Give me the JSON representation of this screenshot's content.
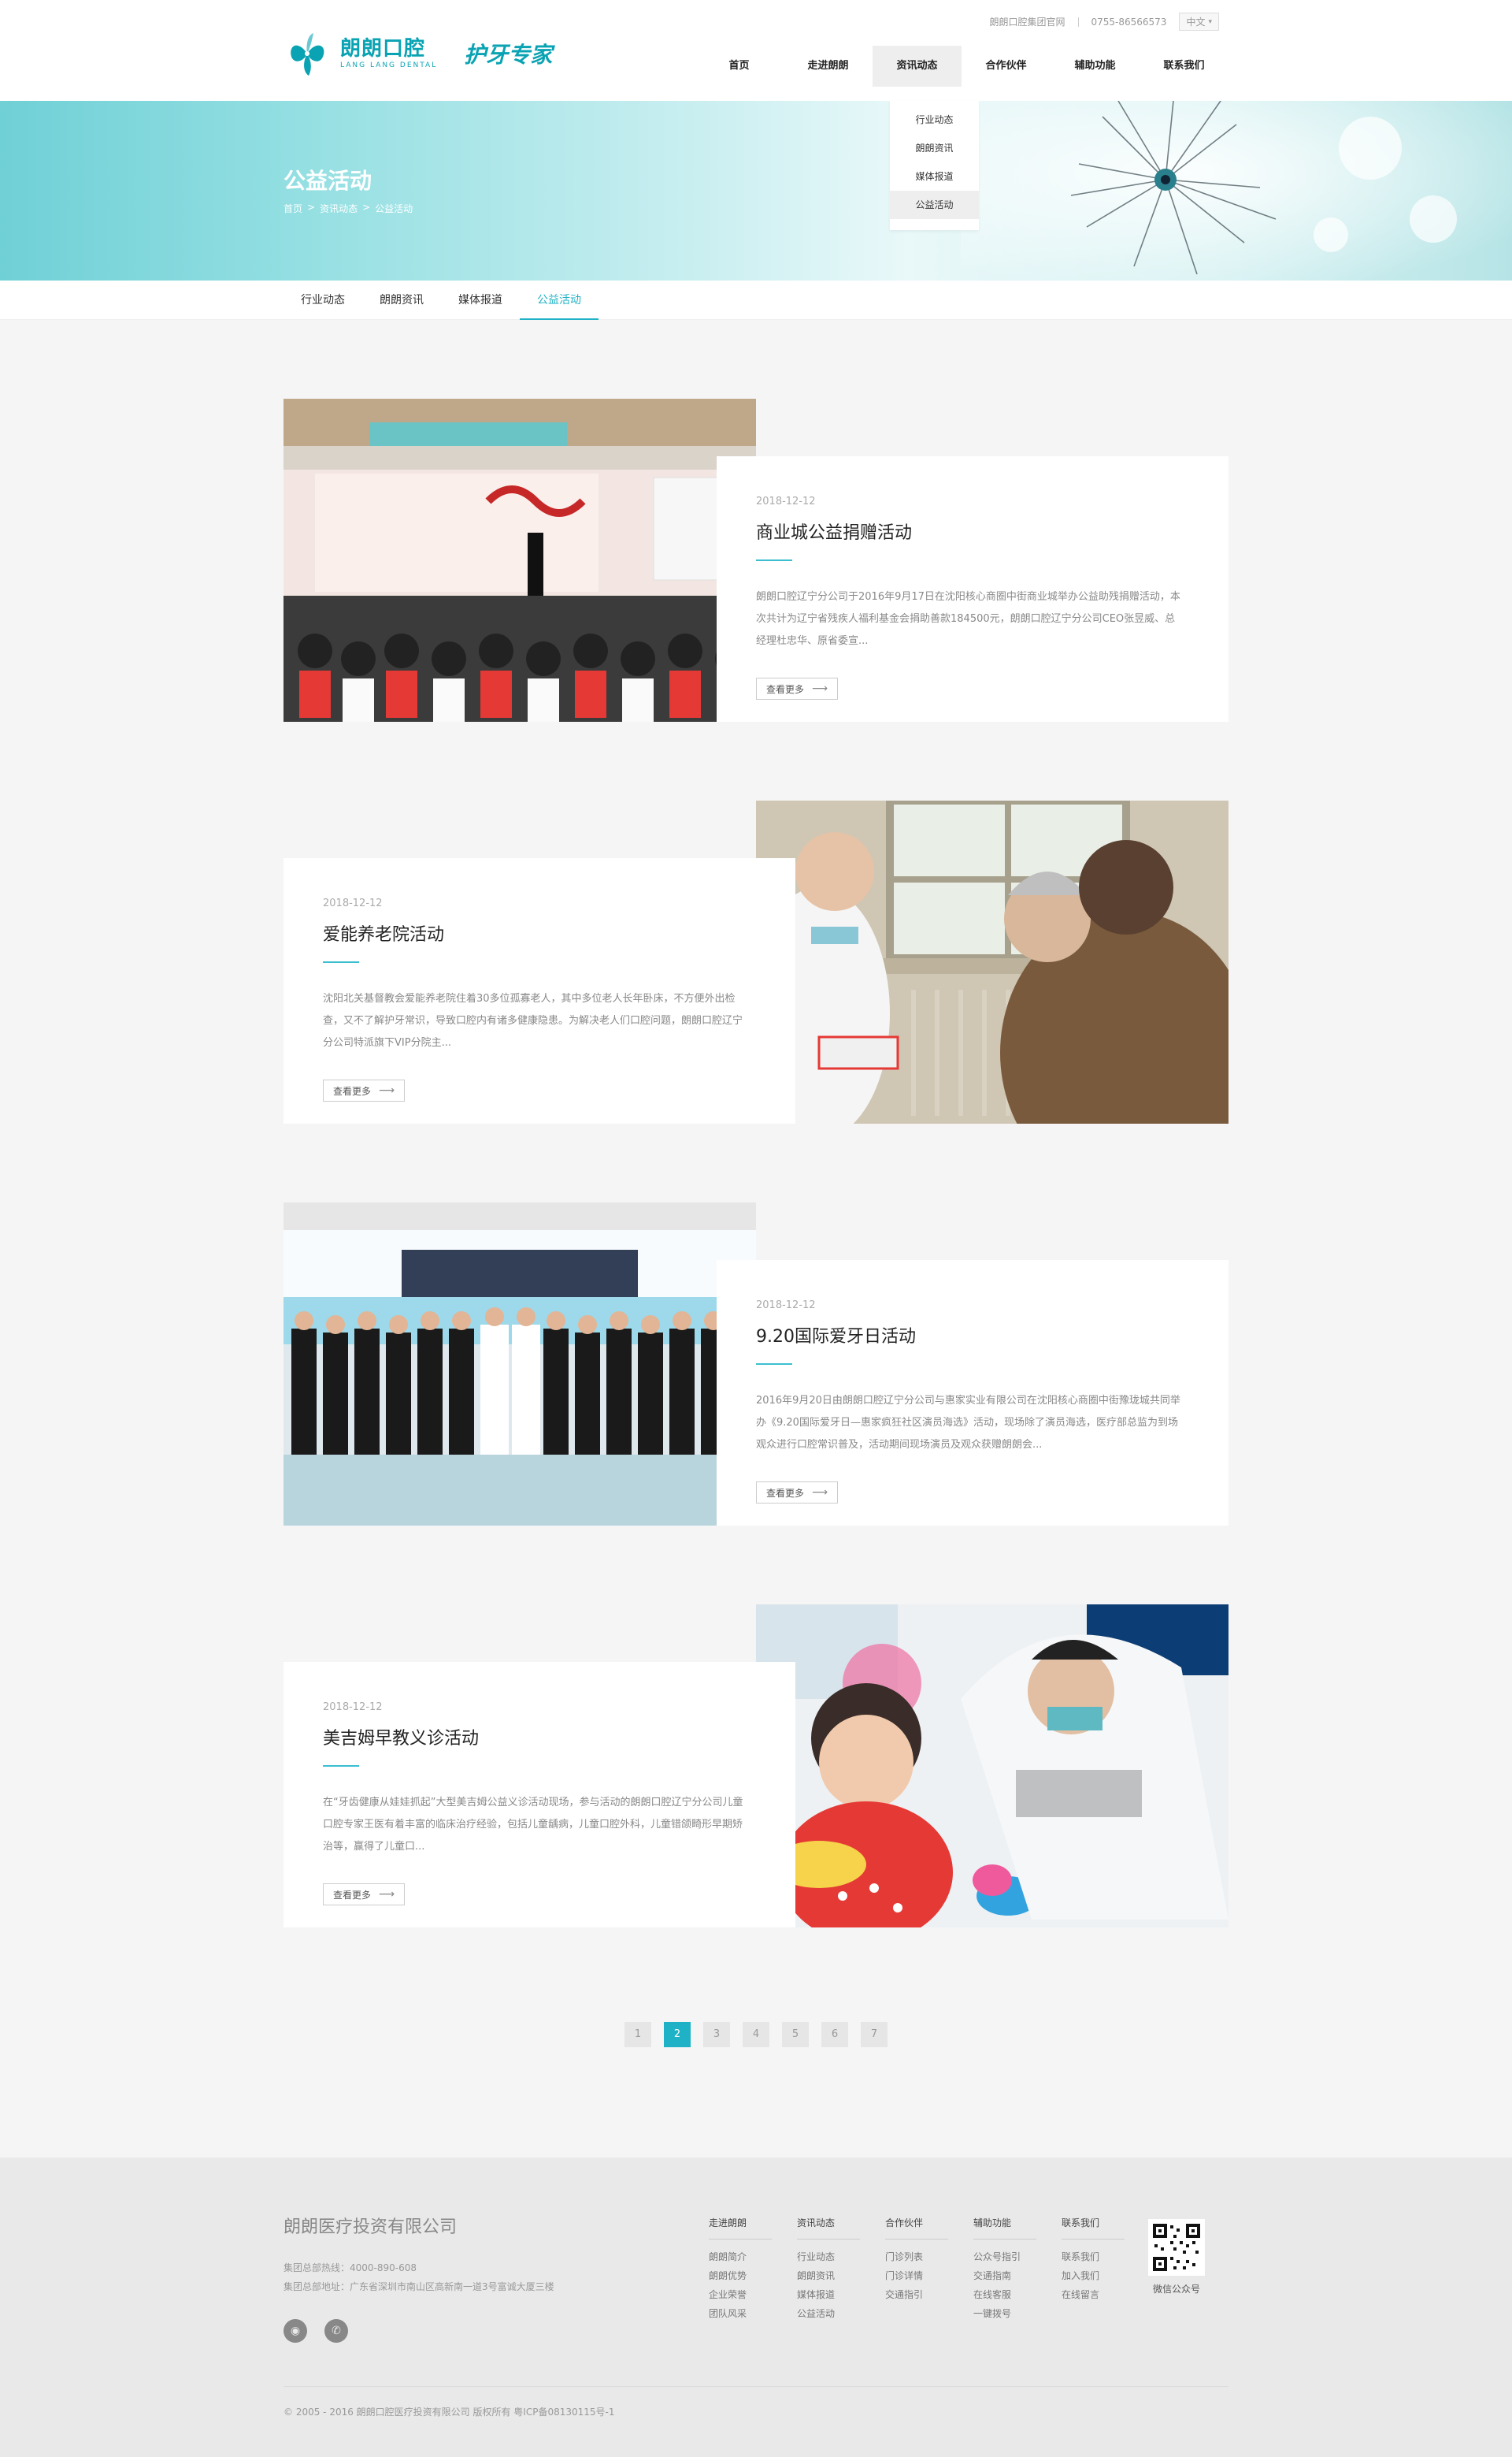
{
  "header": {
    "logo_cn": "朗朗口腔",
    "logo_en": "LANG LANG DENTAL",
    "slogan": "护牙专家",
    "toplink_group": "朗朗口腔集团官网",
    "phone": "0755-86566573",
    "lang": "中文",
    "nav": [
      "首页",
      "走进朗朗",
      "资讯动态",
      "合作伙伴",
      "辅助功能",
      "联系我们"
    ],
    "dropdown": [
      "行业动态",
      "朗朗资讯",
      "媒体报道",
      "公益活动"
    ]
  },
  "banner": {
    "title": "公益活动",
    "breadcrumb": [
      "首页",
      ">",
      "资讯动态",
      ">",
      "公益活动"
    ]
  },
  "subnav": [
    "行业动态",
    "朗朗资讯",
    "媒体报道",
    "公益活动"
  ],
  "articles": [
    {
      "date": "2018-12-12",
      "title": "商业城公益捐赠活动",
      "excerpt": "朗朗口腔辽宁分公司于2016年9月17日在沈阳核心商圈中街商业城举办公益助残捐赠活动，本次共计为辽宁省残疾人福利基金会捐助善款184500元，朗朗口腔辽宁分公司CEO张昱威、总经理杜忠华、原省委宣...",
      "more": "查看更多"
    },
    {
      "date": "2018-12-12",
      "title": "爱能养老院活动",
      "excerpt": "沈阳北关基督教会爱能养老院住着30多位孤寡老人，其中多位老人长年卧床，不方便外出检查，又不了解护牙常识，导致口腔内有诸多健康隐患。为解决老人们口腔问题，朗朗口腔辽宁分公司特派旗下VIP分院主...",
      "more": "查看更多"
    },
    {
      "date": "2018-12-12",
      "title": "9.20国际爱牙日活动",
      "excerpt": "2016年9月20日由朗朗口腔辽宁分公司与惠家实业有限公司在沈阳核心商圈中街豫珑城共同举办《9.20国际爱牙日—惠家疯狂社区演员海选》活动，现场除了演员海选，医疗部总监为到场观众进行口腔常识普及，活动期间现场演员及观众获赠朗朗会...",
      "more": "查看更多"
    },
    {
      "date": "2018-12-12",
      "title": "美吉姆早教义诊活动",
      "excerpt": "在“牙齿健康从娃娃抓起”大型美吉姆公益义诊活动现场，参与活动的朗朗口腔辽宁分公司儿童口腔专家王医有着丰富的临床治疗经验，包括儿童龋病，儿童口腔外科，儿童错颌畸形早期矫治等，赢得了儿童口...",
      "more": "查看更多"
    }
  ],
  "pagination": [
    "1",
    "2",
    "3",
    "4",
    "5",
    "6",
    "7"
  ],
  "pagination_active": "2",
  "footer": {
    "company": "朗朗医疗投资有限公司",
    "hotline": "集团总部热线：4000-890-608",
    "address": "集团总部地址：广东省深圳市南山区高新南一道3号富诚大厦三楼",
    "columns": [
      {
        "title": "走进朗朗",
        "links": [
          "朗朗简介",
          "朗朗优势",
          "企业荣誉",
          "团队风采"
        ]
      },
      {
        "title": "资讯动态",
        "links": [
          "行业动态",
          "朗朗资讯",
          "媒体报道",
          "公益活动"
        ]
      },
      {
        "title": "合作伙伴",
        "links": [
          "门诊列表",
          "门诊详情",
          "交通指引"
        ]
      },
      {
        "title": "辅助功能",
        "links": [
          "公众号指引",
          "交通指南",
          "在线客服",
          "一键拨号"
        ]
      },
      {
        "title": "联系我们",
        "links": [
          "联系我们",
          "加入我们",
          "在线留言"
        ]
      }
    ],
    "qr_label": "微信公众号",
    "copyright": "© 2005 - 2016 朗朗口腔医疗投资有限公司 版权所有 粤ICP备08130115号-1"
  },
  "colors": {
    "accent": "#1fb2c6",
    "brand": "#0aa3b3"
  }
}
